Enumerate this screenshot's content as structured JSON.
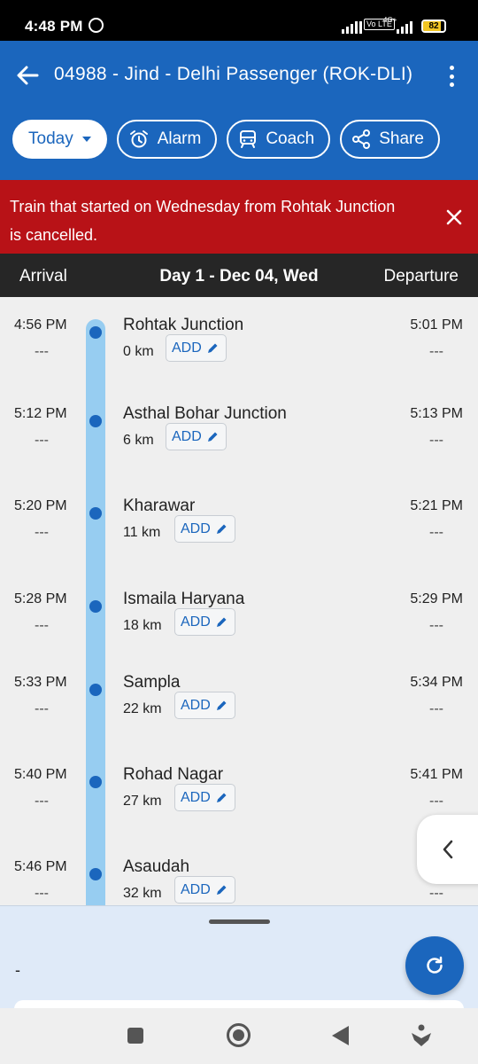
{
  "status_bar": {
    "time": "4:48 PM",
    "battery_level": "82",
    "network": "4G+",
    "volte": "Vo LTE"
  },
  "app_bar": {
    "title": "04988 - Jind - Delhi Passenger (ROK-DLI)"
  },
  "chips": {
    "today": "Today",
    "alarm": "Alarm",
    "coach": "Coach",
    "share": "Share"
  },
  "alert": {
    "message": "Train that started on Wednesday from Rohtak Junction is cancelled."
  },
  "day_header": {
    "arrival": "Arrival",
    "day": "Day 1 - Dec 04, Wed",
    "departure": "Departure"
  },
  "stops": [
    {
      "arrival": "4:56 PM",
      "arrival_actual": "---",
      "name": "Rohtak Junction",
      "distance": "0 km",
      "add_label": "ADD",
      "departure": "5:01 PM",
      "departure_actual": "---"
    },
    {
      "arrival": "5:12 PM",
      "arrival_actual": "---",
      "name": "Asthal Bohar Junction",
      "distance": "6 km",
      "add_label": "ADD",
      "departure": "5:13 PM",
      "departure_actual": "---"
    },
    {
      "arrival": "5:20 PM",
      "arrival_actual": "---",
      "name": "Kharawar",
      "distance": "11 km",
      "add_label": "ADD",
      "departure": "5:21 PM",
      "departure_actual": "---"
    },
    {
      "arrival": "5:28 PM",
      "arrival_actual": "---",
      "name": "Ismaila Haryana",
      "distance": "18 km",
      "add_label": "ADD",
      "departure": "5:29 PM",
      "departure_actual": "---"
    },
    {
      "arrival": "5:33 PM",
      "arrival_actual": "---",
      "name": "Sampla",
      "distance": "22 km",
      "add_label": "ADD",
      "departure": "5:34 PM",
      "departure_actual": "---"
    },
    {
      "arrival": "5:40 PM",
      "arrival_actual": "---",
      "name": "Rohad Nagar",
      "distance": "27 km",
      "add_label": "ADD",
      "departure": "5:41 PM",
      "departure_actual": "---"
    },
    {
      "arrival": "5:46 PM",
      "arrival_actual": "---",
      "name": "Asaudah",
      "distance": "32 km",
      "add_label": "ADD",
      "departure": "5:",
      "departure_actual": "---"
    }
  ],
  "bottom_panel": {
    "text": "-"
  },
  "colors": {
    "primary": "#1b66bd",
    "alert": "#b81217",
    "track": "#97cdf1",
    "header": "#262626"
  }
}
